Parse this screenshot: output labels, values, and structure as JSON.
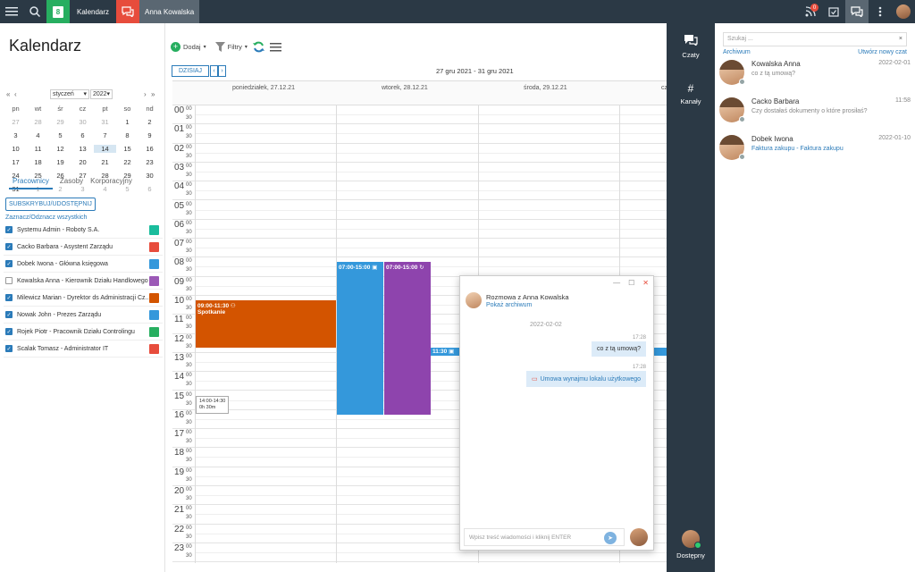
{
  "topbar": {
    "calendar_day": "8",
    "calendar_tab": "Kalendarz",
    "chat_tab": "Anna Kowalska",
    "notif_count": "0"
  },
  "left": {
    "title": "Kalendarz",
    "month": "styczeń",
    "year": "2022",
    "weekdays": [
      "pn",
      "wt",
      "śr",
      "cz",
      "pt",
      "so",
      "nd"
    ],
    "weeks": [
      [
        "27",
        "28",
        "29",
        "30",
        "31",
        "1",
        "2"
      ],
      [
        "3",
        "4",
        "5",
        "6",
        "7",
        "8",
        "9"
      ],
      [
        "10",
        "11",
        "12",
        "13",
        "14",
        "15",
        "16"
      ],
      [
        "17",
        "18",
        "19",
        "20",
        "21",
        "22",
        "23"
      ],
      [
        "24",
        "25",
        "26",
        "27",
        "28",
        "29",
        "30"
      ],
      [
        "31",
        "1",
        "2",
        "3",
        "4",
        "5",
        "6"
      ]
    ],
    "tabs": [
      "Pracownicy",
      "Zasoby",
      "Korporacyjny"
    ],
    "subscribe_label": "SUBSKRYBUJ/UDOSTĘPNIJ",
    "toggle_all": "Zaznacz/Odznacz wszystkich",
    "employees": [
      {
        "name": "Systemu Admin - Roboty S.A.",
        "checked": true,
        "color": "#1abc9c"
      },
      {
        "name": "Cacko Barbara - Asystent Zarządu",
        "checked": true,
        "color": "#e74c3c"
      },
      {
        "name": "Dobek Iwona - Główna księgowa",
        "checked": true,
        "color": "#3498db"
      },
      {
        "name": "Kowalska Anna - Kierownik Działu Handlowego",
        "checked": false,
        "color": "#9b59b6"
      },
      {
        "name": "Milewicz Marian - Dyrektor ds Administracji Cz...",
        "checked": true,
        "color": "#d35400"
      },
      {
        "name": "Nowak John - Prezes Zarządu",
        "checked": true,
        "color": "#3498db"
      },
      {
        "name": "Rojek Piotr - Pracownik Działu Controlingu",
        "checked": true,
        "color": "#27ae60"
      },
      {
        "name": "Scalak Tomasz - Administrator IT",
        "checked": true,
        "color": "#e74c3c"
      }
    ]
  },
  "main": {
    "add_label": "Dodaj",
    "filter_label": "Filtry",
    "today_label": "DZISIAJ",
    "range": "27 gru 2021 - 31 gru 2021",
    "days": [
      "poniedziałek, 27.12.21",
      "wtorek, 28.12.21",
      "środa, 29.12.21",
      "cz"
    ],
    "hours": [
      "00",
      "01",
      "02",
      "03",
      "04",
      "05",
      "06",
      "07",
      "08",
      "09",
      "10",
      "11",
      "12",
      "13",
      "14",
      "15",
      "16",
      "17",
      "18",
      "19",
      "20",
      "21",
      "22",
      "23"
    ],
    "min0": "00",
    "min30": "30",
    "events": [
      {
        "time": "09:00-11:30",
        "title": "Spotkanie",
        "color": "#d35400"
      },
      {
        "time": "07:00-15:00",
        "title": "",
        "color": "#3498db"
      },
      {
        "time": "07:00-15:00",
        "title": "",
        "color": "#8e44ad"
      },
      {
        "time": "11:30",
        "title": "",
        "color": "#3498db"
      }
    ],
    "tooltip_time": "14:00-14:30",
    "tooltip_dur": "0h 30m"
  },
  "rightnav": {
    "chats": "Czaty",
    "channels": "Kanały",
    "status": "Dostępny"
  },
  "chatlist": {
    "search_placeholder": "Szukaj ...",
    "archive": "Archiwum",
    "new_chat": "Utwórz nowy czat",
    "conversations": [
      {
        "name": "Kowalska Anna",
        "msg": "co z tą umową?",
        "date": "2022-02-01"
      },
      {
        "name": "Cacko Barbara",
        "msg": "Czy dostałaś dokumenty o które prosiłaś?",
        "date": "11:58"
      },
      {
        "name": "Dobek Iwona",
        "msg": "Faktura zakupu - Faktura zakupu",
        "date": "2022-01-10"
      }
    ]
  },
  "popup": {
    "title": "Rozmowa z Anna Kowalska",
    "archive": "Pokaż archiwum",
    "date": "2022-02-02",
    "messages": [
      {
        "time": "17:28",
        "text": "co z tą umową?"
      },
      {
        "time": "17:28",
        "text": "Umowa wynajmu lokalu użytkowego"
      }
    ],
    "input_placeholder": "Wpisz treść wiadomości i kliknij ENTER"
  }
}
